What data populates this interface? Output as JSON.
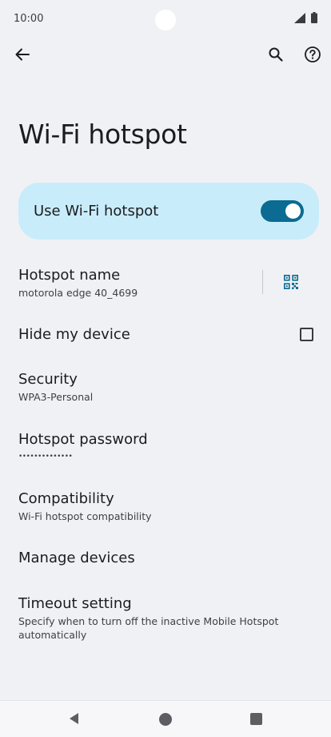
{
  "status_bar": {
    "time": "10:00"
  },
  "header": {
    "title": "Wi-Fi hotspot"
  },
  "main_toggle": {
    "label": "Use Wi-Fi hotspot",
    "enabled": true
  },
  "settings": [
    {
      "title": "Hotspot name",
      "subtitle": "motorola edge 40_4699"
    },
    {
      "title": "Hide my device",
      "checked": false
    },
    {
      "title": "Security",
      "subtitle": "WPA3-Personal"
    },
    {
      "title": "Hotspot password",
      "subtitle": "••••••••••••••"
    },
    {
      "title": "Compatibility",
      "subtitle": "Wi-Fi hotspot compatibility"
    },
    {
      "title": "Manage devices"
    },
    {
      "title": "Timeout setting",
      "subtitle": "Specify when to turn off the inactive Mobile Hotspot automatically"
    }
  ],
  "icons": {
    "back": "arrow-left-icon",
    "search": "search-icon",
    "help": "help-circle-icon",
    "qr": "qr-code-icon",
    "signal": "signal-icon",
    "battery": "battery-icon"
  },
  "colors": {
    "background": "#f0f1f4",
    "toggle_card": "#c9ecfa",
    "switch_on": "#0b6b92",
    "qr_accent": "#0b6b92"
  }
}
